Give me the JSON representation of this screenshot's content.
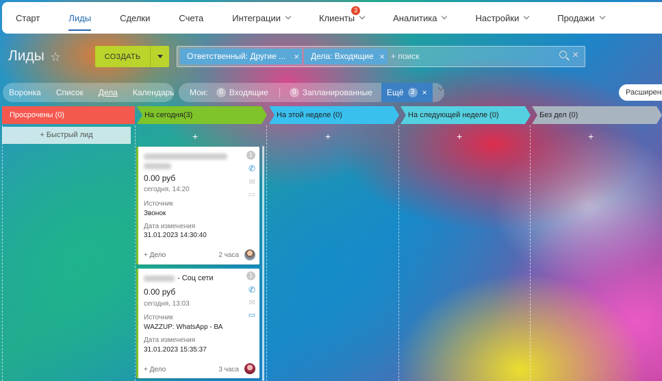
{
  "nav": {
    "items": [
      {
        "label": "Старт",
        "chevron": false
      },
      {
        "label": "Лиды",
        "chevron": false,
        "active": true
      },
      {
        "label": "Сделки",
        "chevron": false
      },
      {
        "label": "Счета",
        "chevron": false
      },
      {
        "label": "Интеграции",
        "chevron": true
      },
      {
        "label": "Клиенты",
        "chevron": true,
        "badge": "3"
      },
      {
        "label": "Аналитика",
        "chevron": true
      },
      {
        "label": "Настройки",
        "chevron": true
      },
      {
        "label": "Продажи",
        "chevron": true
      }
    ]
  },
  "header": {
    "title": "Лиды",
    "create_label": "СОЗДАТЬ"
  },
  "filter": {
    "tags": [
      "Ответственный: Другие ...",
      "Дела: Входящие"
    ],
    "search_placeholder": "+ поиск"
  },
  "views": {
    "items": [
      "Воронка",
      "Список",
      "Дела",
      "Календарь"
    ],
    "active": "Дела"
  },
  "counters": {
    "label": "Мои:",
    "incoming_count": "0",
    "incoming_label": "Входящие",
    "planned_count": "0",
    "planned_label": "Запланированные",
    "more_label": "Ещё",
    "more_count": "3"
  },
  "extended_label": "Расширенн",
  "columns": [
    {
      "title": "Просрочены",
      "count": "(0)",
      "color": "#f4584f"
    },
    {
      "title": "На сегодня",
      "count": "(3)",
      "color": "#7ec42a"
    },
    {
      "title": "На этой неделе",
      "count": "(0)",
      "color": "#39c0ef"
    },
    {
      "title": "На следующей неделе",
      "count": "(0)",
      "color": "#55d0e0"
    },
    {
      "title": "Без дел",
      "count": "(0)",
      "color": "#a8b4c0"
    }
  ],
  "quick_lead_label": "+ Быстрый лид",
  "plus_sign": "+",
  "cards": [
    {
      "title_suffix": "",
      "badge": "1",
      "amount": "0.00 руб",
      "date": "сегодня, 14:20",
      "source_label": "Источник",
      "source_value": "Звонок",
      "modified_label": "Дата изменения",
      "modified_value": "31.01.2023 14:30:40",
      "add_deal": "+ Дело",
      "time_ago": "2 часа"
    },
    {
      "title_suffix": "- Соц сети",
      "badge": "1",
      "amount": "0.00 руб",
      "date": "сегодня, 13:03",
      "source_label": "Источник",
      "source_value": "WAZZUP: WhatsApp - ВА",
      "modified_label": "Дата изменения",
      "modified_value": "31.01.2023 15:35:37",
      "add_deal": "+ Дело",
      "time_ago": "3 часа"
    }
  ]
}
